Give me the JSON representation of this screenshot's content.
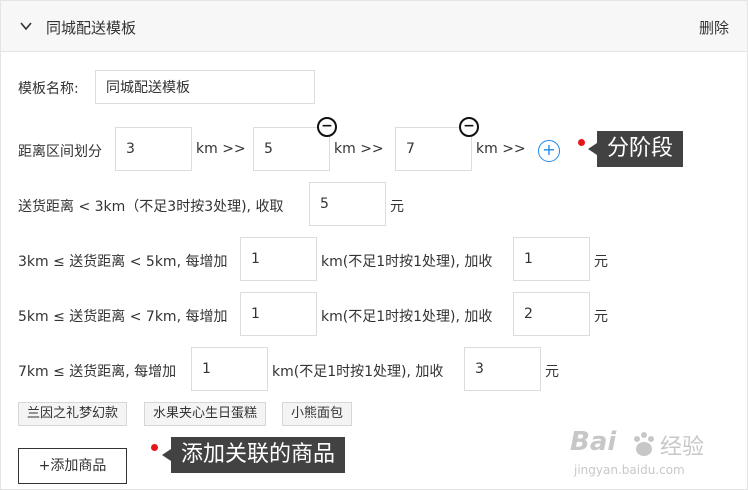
{
  "header": {
    "title": "同城配送模板",
    "delete_label": "删除"
  },
  "template_name": {
    "label": "模板名称:",
    "value": "同城配送模板"
  },
  "distance": {
    "label": "距离区间划分",
    "values": [
      "3",
      "5",
      "7"
    ],
    "unit_arrow": "km  >>"
  },
  "rule1": {
    "text": "送货距离 < 3km（不足3时按3处理), 收取",
    "value": "5",
    "currency": "元"
  },
  "rule2": {
    "prefix": "3km ≤ 送货距离 < 5km,  每增加",
    "step": "1",
    "mid": "km(不足1时按1处理), 加收",
    "fee": "1",
    "currency": "元"
  },
  "rule3": {
    "prefix": "5km ≤ 送货距离 < 7km,  每增加",
    "step": "1",
    "mid": "km(不足1时按1处理), 加收",
    "fee": "2",
    "currency": "元"
  },
  "rule4": {
    "prefix": "7km ≤ 送货距离,  每增加",
    "step": "1",
    "mid": "km(不足1时按1处理), 加收",
    "fee": "3",
    "currency": "元"
  },
  "tags": [
    "兰因之礼梦幻款",
    "水果夹心生日蛋糕",
    "小熊面包"
  ],
  "add_products_label": "+添加商品",
  "annotations": {
    "segment": "分阶段",
    "related": "添加关联的商品"
  },
  "watermark": {
    "brand": "Bai",
    "brand2": "经验",
    "url": "jingyan.baidu.com"
  },
  "colors": {
    "accent": "#1e88e5",
    "callout_bg": "#424242",
    "marker": "#e8161c"
  }
}
